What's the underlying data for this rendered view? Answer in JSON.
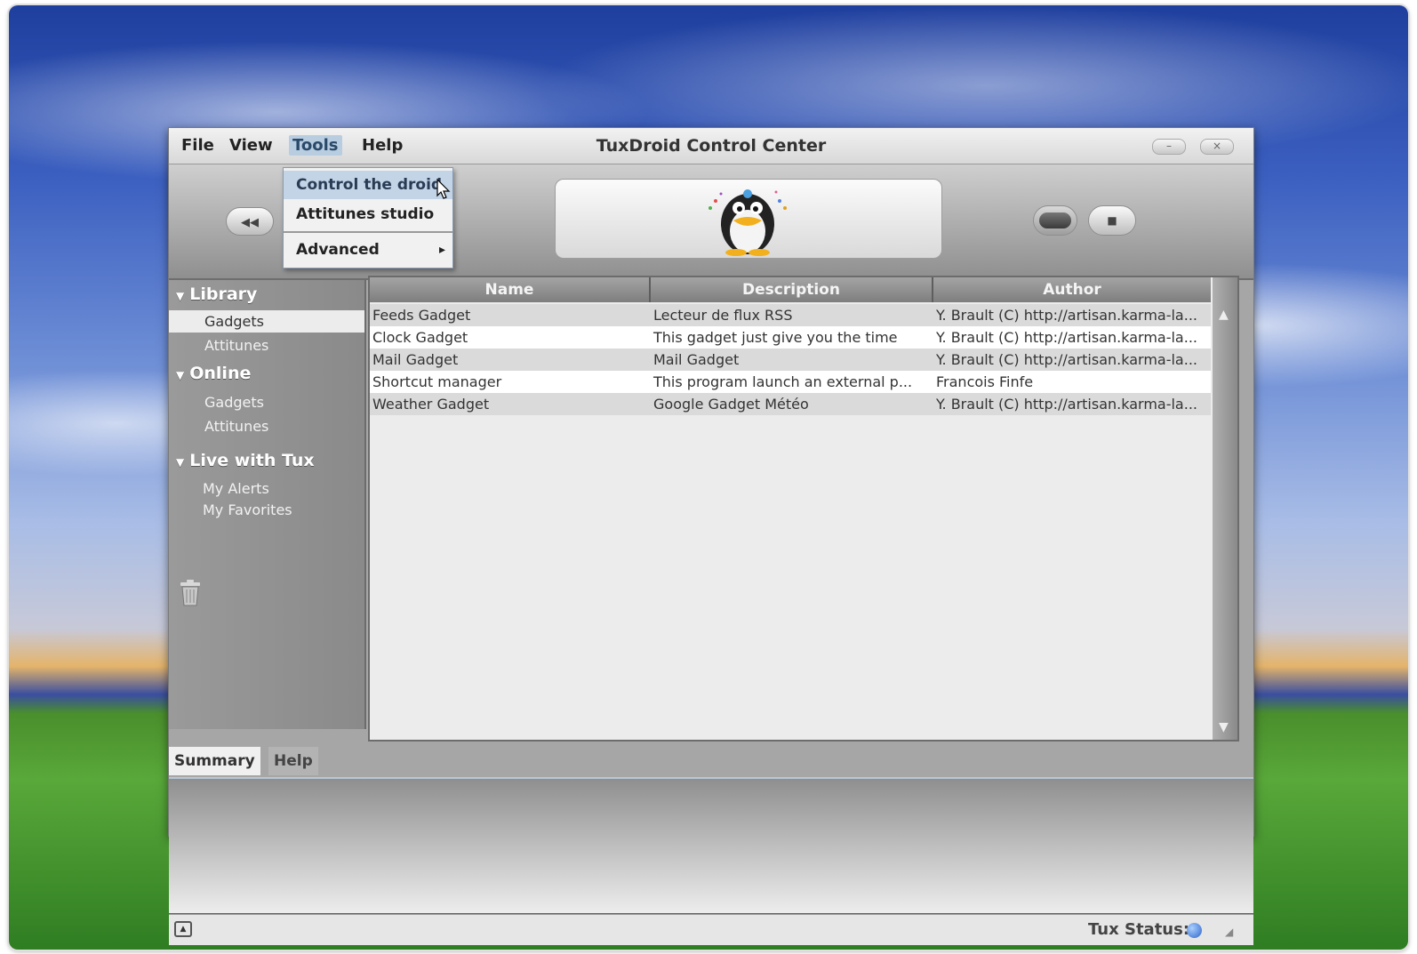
{
  "window": {
    "title": "TuxDroid Control Center",
    "menu": [
      "File",
      "View",
      "Tools",
      "Help"
    ],
    "minimize": "–",
    "close": "×"
  },
  "tools_menu": {
    "items": [
      "Control the droid",
      "Attitunes studio",
      "Advanced"
    ],
    "submenu_arrow": "▸"
  },
  "toolbar": {
    "back": "◀◀",
    "stop": "■"
  },
  "sidebar": {
    "library": {
      "title": "Library",
      "items": [
        "Gadgets",
        "Attitunes"
      ]
    },
    "online": {
      "title": "Online",
      "items": [
        "Gadgets",
        "Attitunes"
      ]
    },
    "live": {
      "title": "Live with Tux",
      "items": [
        "My Alerts",
        "My Favorites"
      ]
    },
    "expander": "▼"
  },
  "table": {
    "columns": [
      "Name",
      "Description",
      "Author"
    ],
    "rows": [
      [
        "Feeds Gadget",
        "Lecteur de flux RSS",
        "Y. Brault (C) http://artisan.karma-la..."
      ],
      [
        "Clock Gadget",
        "This gadget just give you the time",
        "Y. Brault (C) http://artisan.karma-la..."
      ],
      [
        "Mail Gadget",
        "Mail Gadget",
        "Y. Brault (C) http://artisan.karma-la..."
      ],
      [
        "Shortcut manager",
        "This program launch an external p...",
        "Francois Finfe"
      ],
      [
        "Weather Gadget",
        "Google Gadget Météo",
        "Y. Brault (C) http://artisan.karma-la..."
      ]
    ]
  },
  "tabs": [
    "Summary",
    "Help"
  ],
  "status": {
    "label": "Tux Status:"
  }
}
